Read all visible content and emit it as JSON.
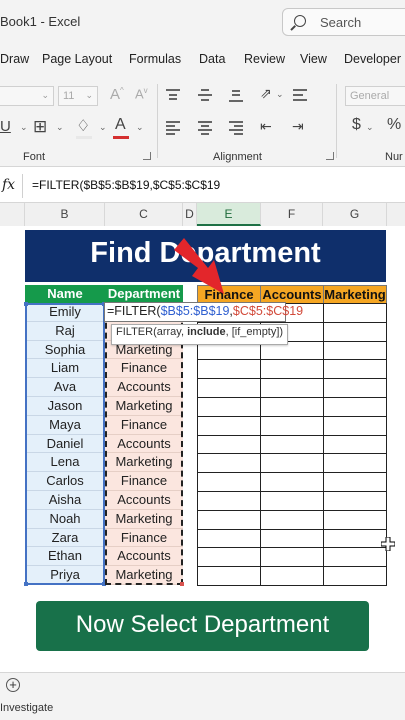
{
  "app": {
    "title": "Book1  -  Excel",
    "search": "Search"
  },
  "ribbon_tabs": [
    "Draw",
    "Page Layout",
    "Formulas",
    "Data",
    "Review",
    "View",
    "Developer"
  ],
  "ribbon": {
    "font_size": "11",
    "number_format": "General",
    "groups": {
      "font": "Font",
      "alignment": "Alignment",
      "number": "Nur"
    }
  },
  "formula_bar": {
    "fx": "fx",
    "formula": "=FILTER($B$5:$B$19,$C$5:$C$19"
  },
  "columns": [
    "B",
    "C",
    "D",
    "E",
    "F",
    "G"
  ],
  "sheet": {
    "banner": "Find Department",
    "headers": {
      "name": "Name",
      "department": "Department",
      "finance": "Finance",
      "accounts": "Accounts",
      "marketing": "Marketing"
    },
    "rows": [
      {
        "name": "Emily",
        "department": ""
      },
      {
        "name": "Raj",
        "department": ""
      },
      {
        "name": "Sophia",
        "department": "Marketing"
      },
      {
        "name": "Liam",
        "department": "Finance"
      },
      {
        "name": "Ava",
        "department": "Accounts"
      },
      {
        "name": "Jason",
        "department": "Marketing"
      },
      {
        "name": "Maya",
        "department": "Finance"
      },
      {
        "name": "Daniel",
        "department": "Accounts"
      },
      {
        "name": "Lena",
        "department": "Marketing"
      },
      {
        "name": "Carlos",
        "department": "Finance"
      },
      {
        "name": "Aisha",
        "department": "Accounts"
      },
      {
        "name": "Noah",
        "department": "Marketing"
      },
      {
        "name": "Zara",
        "department": "Finance"
      },
      {
        "name": "Ethan",
        "department": "Accounts"
      },
      {
        "name": "Priya",
        "department": "Marketing"
      }
    ],
    "edit": {
      "prefix": "=FILTER(",
      "range1": "$B$5:$B$19",
      "comma": ",",
      "range2": "$C$5:$C$19"
    },
    "tooltip": {
      "pre": "FILTER(array, ",
      "bold": "include",
      "post": ", [if_empty])"
    }
  },
  "cta": "Now Select Department",
  "status": "Investigate",
  "colors": {
    "banner": "#0f2f6b",
    "header_green": "#159a4b",
    "header_orange": "#f5a623",
    "cta": "#18714a",
    "arrow": "#e3262b"
  }
}
